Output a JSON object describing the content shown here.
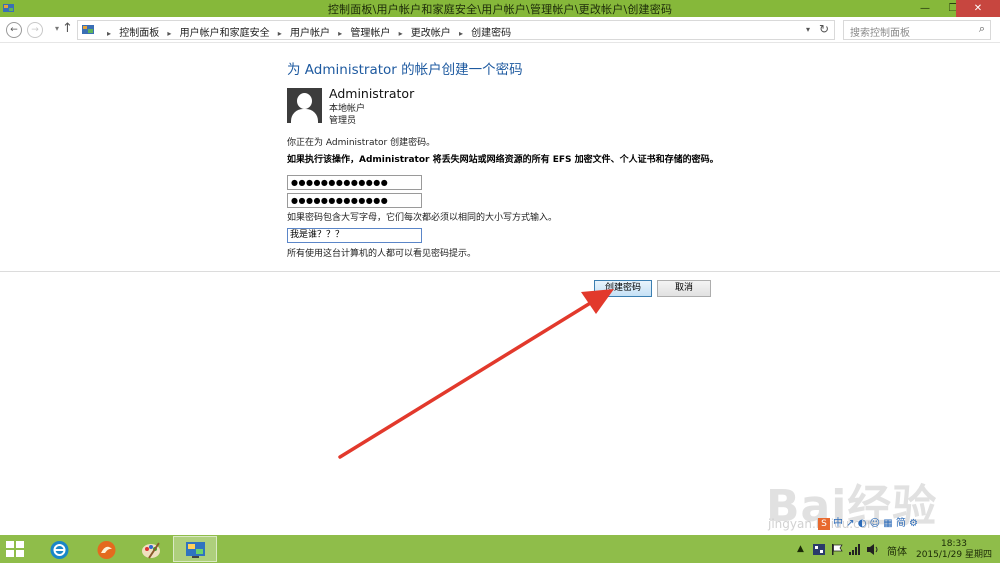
{
  "window": {
    "title": "控制面板\\用户帐户和家庭安全\\用户帐户\\管理帐户\\更改帐户\\创建密码",
    "controls": {
      "minimize": "—",
      "maximize": "❐",
      "close": "✕"
    }
  },
  "nav": {
    "back": "←",
    "forward": "→",
    "up": "↑",
    "breadcrumbs": [
      "控制面板",
      "用户帐户和家庭安全",
      "用户帐户",
      "管理帐户",
      "更改帐户",
      "创建密码"
    ],
    "refresh": "↻",
    "search_placeholder": "搜索控制面板",
    "search_icon": "⌕"
  },
  "main": {
    "heading": "为 Administrator 的帐户创建一个密码",
    "user": {
      "name": "Administrator",
      "type": "本地帐户",
      "role": "管理员"
    },
    "note_creating": "你正在为 Administrator 创建密码。",
    "warning": "如果执行该操作，Administrator 将丢失网站或网络资源的所有 EFS 加密文件、个人证书和存储的密码。",
    "password_value": "●●●●●●●●●●●●●",
    "confirm_value": "●●●●●●●●●●●●●",
    "case_note": "如果密码包含大写字母，它们每次都必须以相同的大小写方式输入。",
    "hint_value": "我是谁？？？",
    "hint_note": "所有使用这台计算机的人都可以看见密码提示。",
    "create_button": "创建密码",
    "cancel_button": "取消"
  },
  "watermark": {
    "brand": "Bai经验",
    "url": "jingyan.baidu.com",
    "ime_text": "中 ↗ ◐ ☺ ▦ 简 ⚙"
  },
  "taskbar": {
    "apps": [
      "start-button",
      "ie-icon",
      "fox-icon",
      "paint-icon",
      "control-panel-icon"
    ],
    "tray_arrow": "▲",
    "language": "简体",
    "time": "18:33",
    "date": "2015/1/29 星期四"
  },
  "colors": {
    "accent_heading": "#1e5aa0",
    "taskbar": "#8fbd4a",
    "titlebar": "#86b83a",
    "arrow": "#e2392c"
  }
}
